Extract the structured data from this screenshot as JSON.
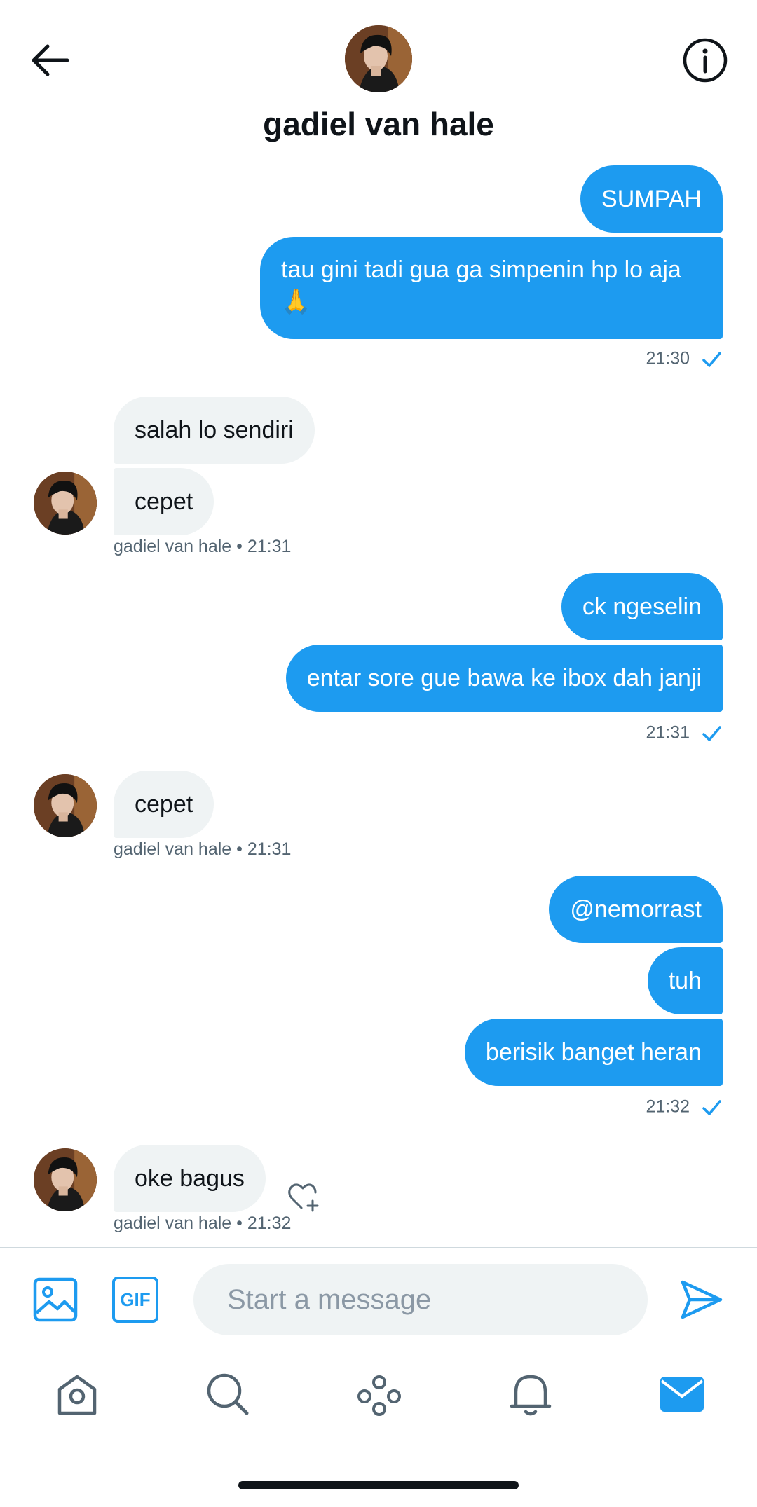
{
  "header": {
    "back_icon": "arrow-left-icon",
    "contact_name": "gadiel van hale",
    "info_icon": "info-circle-icon"
  },
  "messages": {
    "group1": {
      "out1": "SUMPAH",
      "out2": "tau gini tadi gua ga simpenin hp lo aja 🙏",
      "time": "21:30"
    },
    "group2": {
      "in1": "salah lo sendiri",
      "in2": "cepet",
      "meta": "gadiel van hale • 21:31"
    },
    "group3": {
      "out1": "ck ngeselin",
      "out2": "entar sore gue bawa ke ibox dah janji",
      "time": "21:31"
    },
    "group4": {
      "in1": "cepet",
      "meta": "gadiel van hale • 21:31"
    },
    "group5": {
      "out1": "@nemorrast",
      "out2": "tuh",
      "out3": "berisik banget heran",
      "time": "21:32"
    },
    "group6": {
      "in1": "oke bagus",
      "meta": "gadiel van hale • 21:32"
    }
  },
  "composer": {
    "placeholder": "Start a message",
    "gif_label": "GIF",
    "media_icon": "image-icon",
    "send_icon": "send-icon"
  },
  "nav": {
    "items": [
      "home-icon",
      "search-icon",
      "spaces-icon",
      "notifications-icon",
      "messages-icon"
    ],
    "active": "messages-icon"
  },
  "colors": {
    "accent": "#1d9bf0",
    "incoming_bubble": "#eff3f4",
    "meta_text": "#536471"
  }
}
